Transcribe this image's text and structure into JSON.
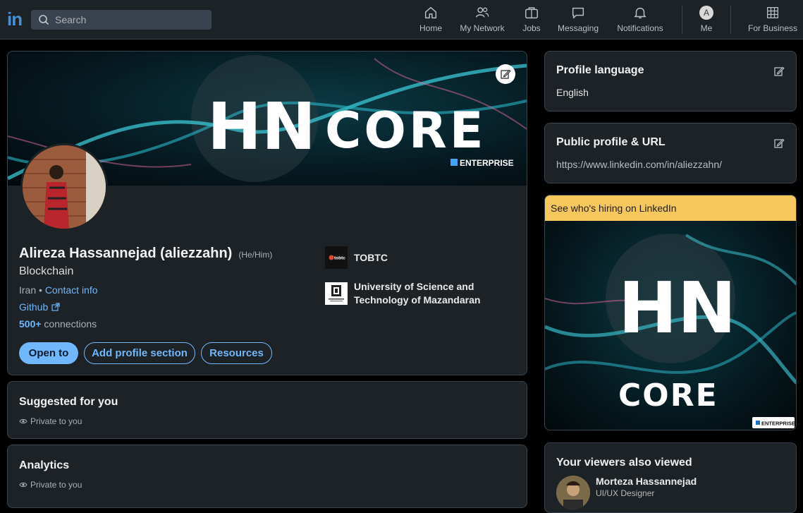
{
  "header": {
    "logo": "in",
    "search_placeholder": "Search",
    "nav": [
      {
        "label": "Home",
        "icon": "home-icon"
      },
      {
        "label": "My Network",
        "icon": "network-icon"
      },
      {
        "label": "Jobs",
        "icon": "briefcase-icon"
      },
      {
        "label": "Messaging",
        "icon": "messaging-icon"
      },
      {
        "label": "Notifications",
        "icon": "bell-icon"
      },
      {
        "label": "Me",
        "icon": "avatar-icon",
        "avatar_letter": "A"
      },
      {
        "label": "For Business",
        "icon": "grid-icon"
      }
    ]
  },
  "banner": {
    "brand_left": "HN",
    "brand_right": "CORE",
    "badge": "ENTERPRISE"
  },
  "profile": {
    "name": "Alireza Hassannejad (aliezzahn)",
    "pronouns": "(He/Him)",
    "headline": "Blockchain",
    "location": "Iran",
    "separator": " • ",
    "contact_info": "Contact info",
    "website": "Github",
    "connections_count": "500+",
    "connections_label": " connections",
    "buttons": {
      "open_to": "Open to",
      "add_section": "Add profile section",
      "resources": "Resources"
    },
    "orgs": [
      {
        "name": "TOBTC"
      },
      {
        "name_line1": "University of Science and",
        "name_line2": "Technology of Mazandaran"
      }
    ]
  },
  "sections": {
    "suggested": {
      "title": "Suggested for you",
      "privacy": "Private to you"
    },
    "analytics": {
      "title": "Analytics",
      "privacy": "Private to you"
    }
  },
  "sidebar": {
    "language": {
      "title": "Profile language",
      "value": "English"
    },
    "public_url": {
      "title": "Public profile & URL",
      "value": "https://www.linkedin.com/in/aliezzahn/"
    },
    "ad": {
      "heading": "See who's hiring on LinkedIn",
      "brand_top": "HN",
      "brand_bottom": "CORE",
      "badge": "ENTERPRISE"
    },
    "viewers": {
      "title": "Your viewers also viewed",
      "person_name": "Morteza Hassannejad",
      "person_title": "UI/UX Designer"
    }
  },
  "colors": {
    "accent": "#71b7fb",
    "card": "#1d2226",
    "ad_header": "#f5c75d",
    "linkedin_blue": "#4a8ed6"
  }
}
